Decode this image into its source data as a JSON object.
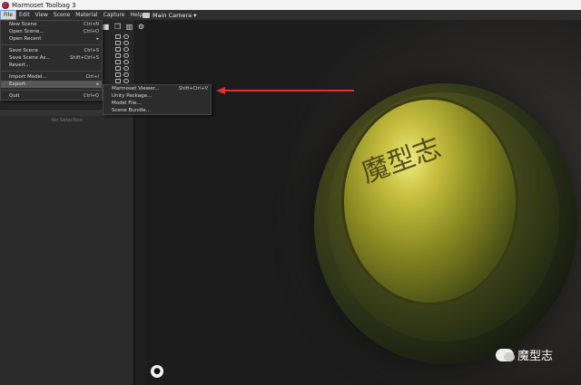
{
  "window": {
    "title": "Marmoset Toolbag 3"
  },
  "menubar": {
    "items": [
      "File",
      "Edit",
      "View",
      "Scene",
      "Material",
      "Capture",
      "Help"
    ]
  },
  "camera": {
    "label": "Main Camera ▾"
  },
  "file_menu": {
    "items": [
      {
        "label": "New Scene",
        "shortcut": "Ctrl+N"
      },
      {
        "label": "Open Scene...",
        "shortcut": "Ctrl+O"
      },
      {
        "label": "Open Recent",
        "shortcut": "▸"
      },
      {
        "label": "Save Scene",
        "shortcut": "Ctrl+S"
      },
      {
        "label": "Save Scene As...",
        "shortcut": "Shift+Ctrl+S"
      },
      {
        "label": "Revert...",
        "shortcut": ""
      },
      {
        "label": "Import Model...",
        "shortcut": "Ctrl+I"
      },
      {
        "label": "Export",
        "shortcut": "▸"
      },
      {
        "label": "Quit",
        "shortcut": "Ctrl+Q"
      }
    ]
  },
  "export_menu": {
    "items": [
      {
        "label": "Marmoset Viewer...",
        "shortcut": "Shift+Ctrl+V"
      },
      {
        "label": "Unity Package...",
        "shortcut": ""
      },
      {
        "label": "Model File...",
        "shortcut": ""
      },
      {
        "label": "Scene Bundle...",
        "shortcut": ""
      }
    ]
  },
  "panel": {
    "no_selection": "No Selection"
  },
  "viewport": {
    "inscription": "魔型志"
  },
  "watermark": {
    "text": "魔型志"
  },
  "colors": {
    "arrow": "#e03030",
    "menu_highlight": "#585858"
  }
}
